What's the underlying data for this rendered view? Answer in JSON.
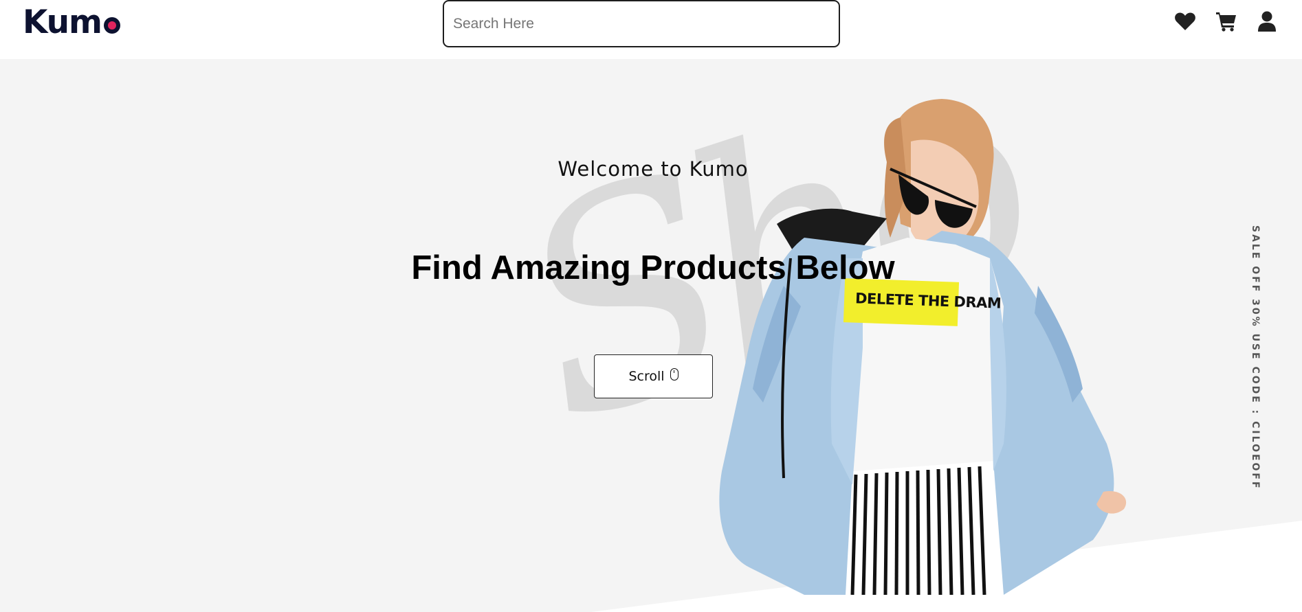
{
  "brand": {
    "name": "Kumo",
    "accent_color": "#e0245e",
    "text_color": "#0d1230"
  },
  "search": {
    "placeholder": "Search Here",
    "value": ""
  },
  "header_icons": [
    {
      "name": "heart-icon"
    },
    {
      "name": "cart-icon"
    },
    {
      "name": "user-icon"
    }
  ],
  "hero": {
    "welcome": "Welcome to Kumo",
    "headline": "Find Amazing Products Below",
    "scroll_label": "Scroll",
    "sale_text": "SALE OFF 30% USE CODE : CILOEOFF",
    "shirt_print": "DELETE THE DRAM",
    "background_color": "#f4f4f4"
  }
}
